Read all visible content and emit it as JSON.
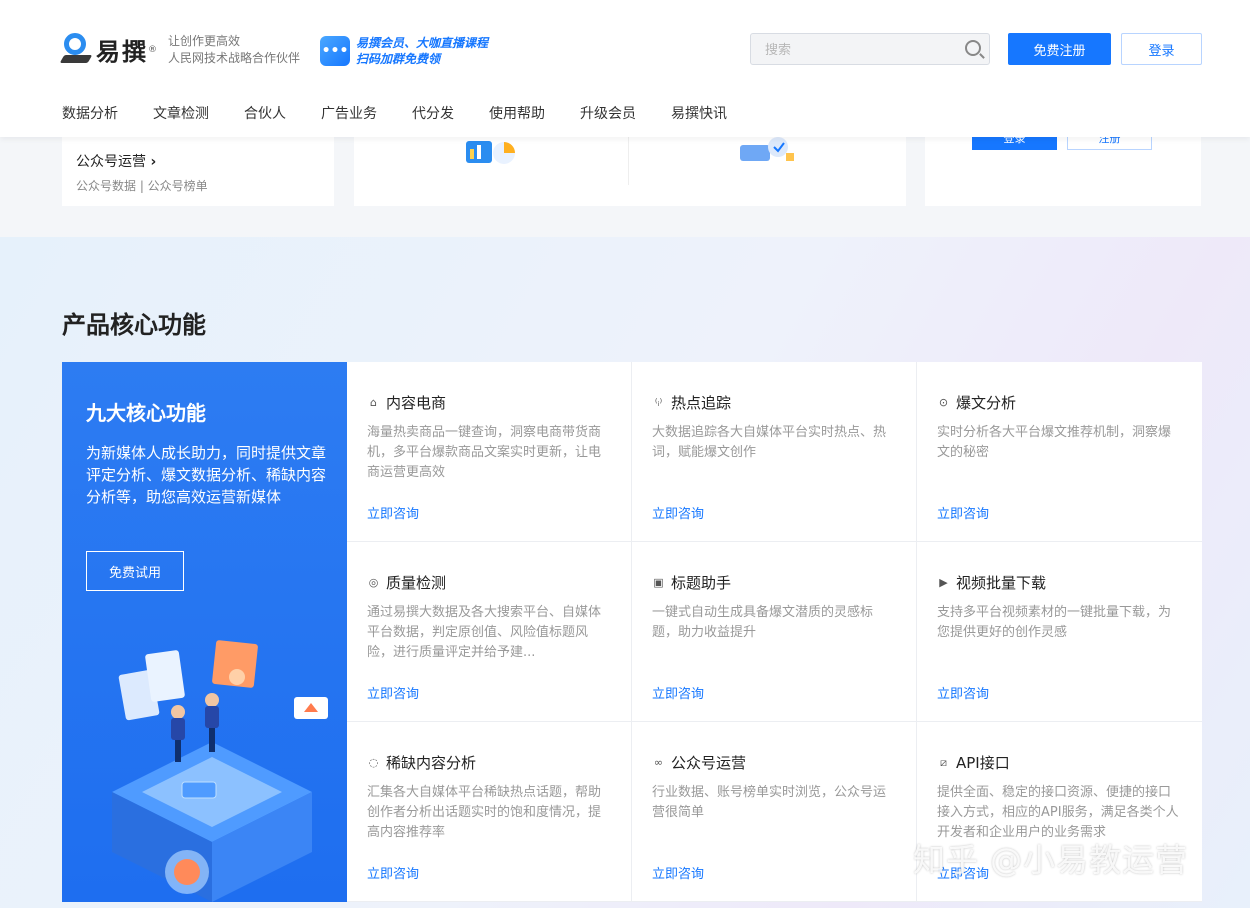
{
  "header": {
    "logo_text": "易撰",
    "logo_reg": "®",
    "slogan_line1": "让创作更高效",
    "slogan_line2": "人民网技术战略合作伙伴",
    "promo_line1": "易撰会员、大咖直播课程",
    "promo_line2": "扫码加群免费领",
    "search_placeholder": "搜索",
    "register_label": "免费注册",
    "login_label": "登录"
  },
  "nav": {
    "items": [
      "数据分析",
      "文章检测",
      "合伙人",
      "广告业务",
      "代分发",
      "使用帮助",
      "升级会员",
      "易撰快讯"
    ]
  },
  "partial": {
    "left_title": "公众号运营",
    "left_subtitle": "公众号数据 | 公众号榜单",
    "right_btn1": "登录",
    "right_btn2": "注册"
  },
  "section": {
    "title": "产品核心功能",
    "panel": {
      "title": "九大核心功能",
      "desc": "为新媒体人成长助力，同时提供文章评定分析、爆文数据分析、稀缺内容分析等，助您高效运营新媒体",
      "button": "免费试用"
    },
    "features": [
      {
        "title": "内容电商",
        "icon": "bag-icon",
        "desc": "海量热卖商品一键查询，洞察电商带货商机，多平台爆款商品文案实时更新，让电商运营更高效",
        "link": "立即咨询"
      },
      {
        "title": "热点追踪",
        "icon": "signal-icon",
        "desc": "大数据追踪各大自媒体平台实时热点、热词，赋能爆文创作",
        "link": "立即咨询"
      },
      {
        "title": "爆文分析",
        "icon": "target-icon",
        "desc": "实时分析各大平台爆文推荐机制，洞察爆文的秘密",
        "link": "立即咨询"
      },
      {
        "title": "质量检测",
        "icon": "check-circle-icon",
        "desc": "通过易撰大数据及各大搜索平台、自媒体平台数据，判定原创值、风险值标题风险，进行质量评定并给予建...",
        "link": "立即咨询"
      },
      {
        "title": "标题助手",
        "icon": "title-doc-icon",
        "desc": "一键式自动生成具备爆文潜质的灵感标题，助力收益提升",
        "link": "立即咨询"
      },
      {
        "title": "视频批量下载",
        "icon": "video-icon",
        "desc": "支持多平台视频素材的一键批量下载，为您提供更好的创作灵感",
        "link": "立即咨询"
      },
      {
        "title": "稀缺内容分析",
        "icon": "chat-icon",
        "desc": "汇集各大自媒体平台稀缺热点话题，帮助创作者分析出话题实时的饱和度情况，提高内容推荐率",
        "link": "立即咨询"
      },
      {
        "title": "公众号运营",
        "icon": "wechat-icon",
        "desc": "行业数据、账号榜单实时浏览，公众号运营很简单",
        "link": "立即咨询"
      },
      {
        "title": "API接口",
        "icon": "api-icon",
        "desc": "提供全面、稳定的接口资源、便捷的接口接入方式，相应的API服务，满足各类个人开发者和企业用户的业务需求",
        "link": "立即咨询"
      }
    ]
  },
  "watermark": "知乎 @小易教运营"
}
